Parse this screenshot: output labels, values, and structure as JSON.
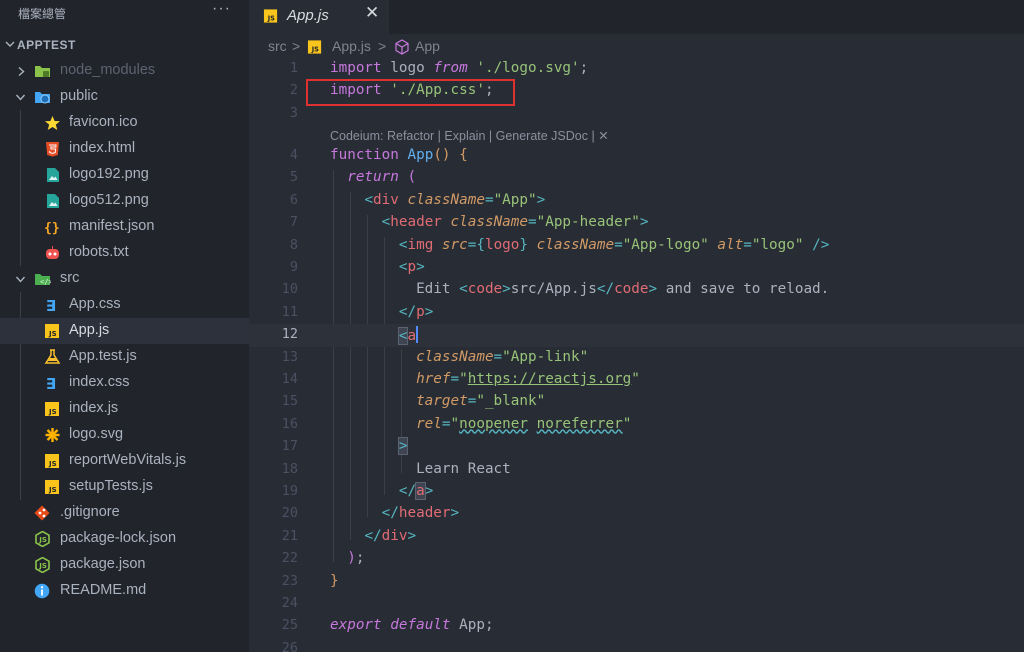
{
  "sidebar": {
    "title": "檔案總管",
    "more": "···",
    "project": "APPTEST",
    "items": [
      {
        "label": "node_modules",
        "icon": "folder-node-icon",
        "dim": true
      },
      {
        "label": "public",
        "icon": "folder-public-icon"
      },
      {
        "label": "favicon.ico",
        "icon": "star-icon"
      },
      {
        "label": "index.html",
        "icon": "html5-icon"
      },
      {
        "label": "logo192.png",
        "icon": "image-file-icon"
      },
      {
        "label": "logo512.png",
        "icon": "image-file-icon"
      },
      {
        "label": "manifest.json",
        "icon": "json-braces-icon"
      },
      {
        "label": "robots.txt",
        "icon": "robot-icon"
      },
      {
        "label": "src",
        "icon": "folder-src-icon"
      },
      {
        "label": "App.css",
        "icon": "css-icon"
      },
      {
        "label": "App.js",
        "icon": "js-icon"
      },
      {
        "label": "App.test.js",
        "icon": "flask-icon"
      },
      {
        "label": "index.css",
        "icon": "css-icon"
      },
      {
        "label": "index.js",
        "icon": "js-icon"
      },
      {
        "label": "logo.svg",
        "icon": "svg-asterisk-icon"
      },
      {
        "label": "reportWebVitals.js",
        "icon": "js-icon"
      },
      {
        "label": "setupTests.js",
        "icon": "js-icon"
      },
      {
        "label": ".gitignore",
        "icon": "git-icon"
      },
      {
        "label": "package-lock.json",
        "icon": "nodejs-icon"
      },
      {
        "label": "package.json",
        "icon": "nodejs-icon"
      },
      {
        "label": "README.md",
        "icon": "info-icon"
      }
    ]
  },
  "tab": {
    "label": "App.js",
    "close": "✕"
  },
  "breadcrumb": {
    "part1": "src",
    "sep": ">",
    "part2": "App.js",
    "part3": "App"
  },
  "codelens": "Codeium: Refactor | Explain | Generate JSDoc | ✕",
  "line_numbers": [
    "1",
    "2",
    "3",
    "4",
    "5",
    "6",
    "7",
    "8",
    "9",
    "10",
    "11",
    "12",
    "13",
    "14",
    "15",
    "16",
    "17",
    "18",
    "19",
    "20",
    "21",
    "22",
    "23",
    "24",
    "25",
    "26"
  ],
  "code": {
    "l1": {
      "kw": "import",
      "a": " logo ",
      "kw2": "from",
      "sp": " ",
      "str": "'./logo.svg'",
      "semi": ";"
    },
    "l2": {
      "kw": "import",
      "sp": " ",
      "str": "'./App.css'",
      "semi": ";"
    },
    "l4": {
      "kw": "function",
      "sp": " ",
      "fn": "App",
      "p1": "()",
      "sp2": " ",
      "br": "{"
    },
    "l5": {
      "kw": "return",
      "sp": " ",
      "p": "("
    },
    "l6": {
      "lt": "<",
      "tag": "div",
      "sp": " ",
      "attr": "className",
      "eq": "=",
      "str": "\"App\"",
      "gt": ">"
    },
    "l7": {
      "lt": "<",
      "tag": "header",
      "sp": " ",
      "attr": "className",
      "eq": "=",
      "str": "\"App-header\"",
      "gt": ">"
    },
    "l8": {
      "lt": "<",
      "tag": "img",
      "sp": " ",
      "attr1": "src",
      "eq1": "=",
      "br1": "{",
      "v1": "logo",
      "br2": "}",
      "sp2": " ",
      "attr2": "className",
      "eq2": "=",
      "str2": "\"App-logo\"",
      "sp3": " ",
      "attr3": "alt",
      "eq3": "=",
      "str3": "\"logo\"",
      "end": " />"
    },
    "l9": {
      "lt": "<",
      "tag": "p",
      "gt": ">"
    },
    "l10": {
      "t1": "Edit ",
      "lt": "<",
      "tag": "code",
      "gt": ">",
      "t2": "src/App.js",
      "lt2": "</",
      "tag2": "code",
      "gt2": ">",
      "t3": " and save to reload."
    },
    "l11": {
      "lt": "</",
      "tag": "p",
      "gt": ">"
    },
    "l12": {
      "lt": "<",
      "tag": "a"
    },
    "l13": {
      "attr": "className",
      "eq": "=",
      "str": "\"App-link\""
    },
    "l14": {
      "attr": "href",
      "eq": "=",
      "q1": "\"",
      "url": "https://reactjs.org",
      "q2": "\""
    },
    "l15": {
      "attr": "target",
      "eq": "=",
      "str": "\"_blank\""
    },
    "l16": {
      "attr": "rel",
      "eq": "=",
      "q1": "\"",
      "w1": "noopener",
      "sp": " ",
      "w2": "noreferrer",
      "q2": "\""
    },
    "l17": {
      "gt": ">"
    },
    "l18": {
      "t": "Learn React"
    },
    "l19": {
      "lt": "</",
      "tag": "a",
      "gt": ">"
    },
    "l20": {
      "lt": "</",
      "tag": "header",
      "gt": ">"
    },
    "l21": {
      "lt": "</",
      "tag": "div",
      "gt": ">"
    },
    "l22": {
      "p": ")",
      "semi": ";"
    },
    "l23": {
      "br": "}"
    },
    "l25": {
      "kw": "export",
      "sp": " ",
      "kw2": "default",
      "sp2": " ",
      "id": "App",
      "semi": ";"
    }
  },
  "colors": {
    "keyword": "#c678dd",
    "function": "#61afef",
    "string": "#98c379",
    "tag": "#e06c75",
    "attribute": "#d19a66",
    "highlight_box": "#e03131"
  }
}
